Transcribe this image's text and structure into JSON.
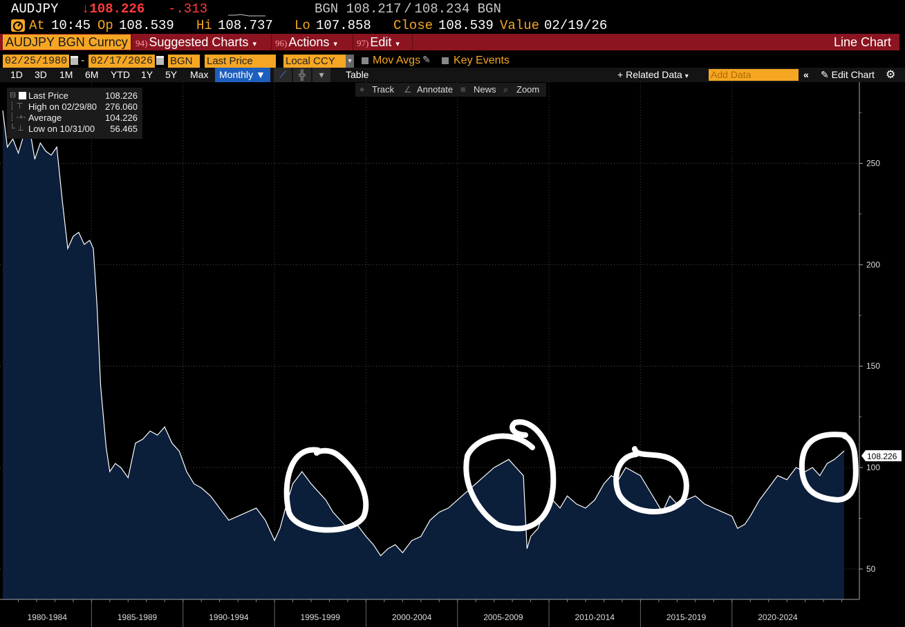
{
  "header": {
    "ticker": "AUDJPY",
    "last_price": "↓108.226",
    "change": "-.313",
    "quote": "BGN 108.217 / 108.234 BGN"
  },
  "quote_line": {
    "at_label": "At",
    "at_value": "10:45",
    "op_label": "Op",
    "op_value": "108.539",
    "hi_label": "Hi",
    "hi_value": "108.737",
    "lo_label": "Lo",
    "lo_value": "107.858",
    "close_label": "Close",
    "close_value": "108.539",
    "value_label": "Value",
    "value_value": "02/19/26"
  },
  "function_bar": {
    "security": "AUDJPY BGN Curncy",
    "suggested_num": "94)",
    "suggested_label": "Suggested Charts",
    "actions_num": "96)",
    "actions_label": "Actions",
    "edit_num": "97)",
    "edit_label": "Edit",
    "title": "Line Chart"
  },
  "settings": {
    "start_date": "02/25/1980",
    "end_date": "02/17/2026",
    "source": "BGN",
    "field": "Last Price",
    "currency": "Local CCY",
    "mov_avgs": "Mov Avgs",
    "key_events": "Key Events"
  },
  "range_bar": {
    "ranges": [
      "1D",
      "3D",
      "1M",
      "6M",
      "YTD",
      "1Y",
      "5Y",
      "Max"
    ],
    "frequency": "Monthly",
    "table": "Table",
    "related_data": "Related Data",
    "add_data_placeholder": "Add Data",
    "edit_chart": "Edit Chart"
  },
  "chart_toolbar": {
    "track": "Track",
    "annotate": "Annotate",
    "news": "News",
    "zoom": "Zoom"
  },
  "legend": {
    "rows": [
      {
        "label": "Last Price",
        "value": "108.226"
      },
      {
        "label": "High on 02/29/80",
        "value": "276.060"
      },
      {
        "label": "Average",
        "value": "104.226"
      },
      {
        "label": "Low on 10/31/00",
        "value": "56.465"
      }
    ]
  },
  "colors": {
    "accent": "#f5a623",
    "down": "#ff3b3b",
    "bar": "#8b1420",
    "fill": "#0b1e3a",
    "selected": "#1d5fbf"
  },
  "chart_data": {
    "type": "area",
    "ylim": [
      35,
      290
    ],
    "yticks": [
      50,
      100,
      150,
      200,
      250
    ],
    "xlim": [
      1980.15,
      2026.13
    ],
    "x_labels": [
      "1980-1984",
      "1985-1989",
      "1990-1994",
      "1995-1999",
      "2000-2004",
      "2005-2009",
      "2010-2014",
      "2015-2019",
      "2020-2024"
    ],
    "last_value_label": "108.226",
    "series": [
      {
        "name": "Last Price",
        "x": [
          1980.15,
          1980.4,
          1980.7,
          1981.0,
          1981.3,
          1981.6,
          1981.9,
          1982.2,
          1982.5,
          1982.8,
          1983.1,
          1983.4,
          1983.7,
          1984.0,
          1984.3,
          1984.6,
          1984.9,
          1985.1,
          1985.3,
          1985.5,
          1985.8,
          1986.0,
          1986.3,
          1986.6,
          1987.0,
          1987.4,
          1987.8,
          1988.2,
          1988.6,
          1989.0,
          1989.4,
          1989.8,
          1990.2,
          1990.6,
          1991.0,
          1991.5,
          1992.0,
          1992.5,
          1993.0,
          1993.5,
          1994.0,
          1994.5,
          1995.0,
          1995.3,
          1995.6,
          1996.0,
          1996.5,
          1997.0,
          1997.4,
          1997.8,
          1998.2,
          1998.6,
          1999.0,
          1999.5,
          2000.0,
          2000.4,
          2000.8,
          2001.2,
          2001.6,
          2002.0,
          2002.5,
          2003.0,
          2003.5,
          2004.0,
          2004.5,
          2005.0,
          2005.5,
          2006.0,
          2006.5,
          2007.0,
          2007.4,
          2007.8,
          2008.2,
          2008.6,
          2008.8,
          2009.0,
          2009.4,
          2009.8,
          2010.2,
          2010.6,
          2011.0,
          2011.5,
          2012.0,
          2012.5,
          2013.0,
          2013.4,
          2013.8,
          2014.2,
          2014.6,
          2015.0,
          2015.4,
          2015.8,
          2016.2,
          2016.6,
          2017.0,
          2017.5,
          2018.0,
          2018.5,
          2019.0,
          2019.5,
          2020.0,
          2020.3,
          2020.7,
          2021.0,
          2021.5,
          2022.0,
          2022.5,
          2023.0,
          2023.5,
          2024.0,
          2024.4,
          2024.8,
          2025.2,
          2025.6,
          2026.13
        ],
        "values": [
          276,
          258,
          262,
          255,
          264,
          268,
          252,
          260,
          256,
          254,
          258,
          232,
          208,
          214,
          216,
          210,
          212,
          208,
          180,
          140,
          110,
          98,
          102,
          100,
          95,
          112,
          114,
          118,
          116,
          120,
          112,
          108,
          98,
          92,
          90,
          86,
          80,
          74,
          76,
          78,
          80,
          74,
          64,
          70,
          80,
          92,
          98,
          92,
          88,
          84,
          78,
          74,
          70,
          72,
          66,
          62,
          56.5,
          60,
          62,
          58,
          64,
          66,
          74,
          78,
          80,
          84,
          88,
          92,
          96,
          100,
          102,
          104,
          100,
          96,
          60,
          66,
          70,
          80,
          84,
          80,
          86,
          82,
          80,
          84,
          92,
          96,
          94,
          100,
          98,
          96,
          90,
          84,
          78,
          86,
          82,
          84,
          86,
          82,
          80,
          78,
          76,
          70,
          72,
          76,
          84,
          90,
          96,
          94,
          100,
          98,
          100,
          96,
          102,
          104,
          108.2
        ]
      }
    ]
  }
}
